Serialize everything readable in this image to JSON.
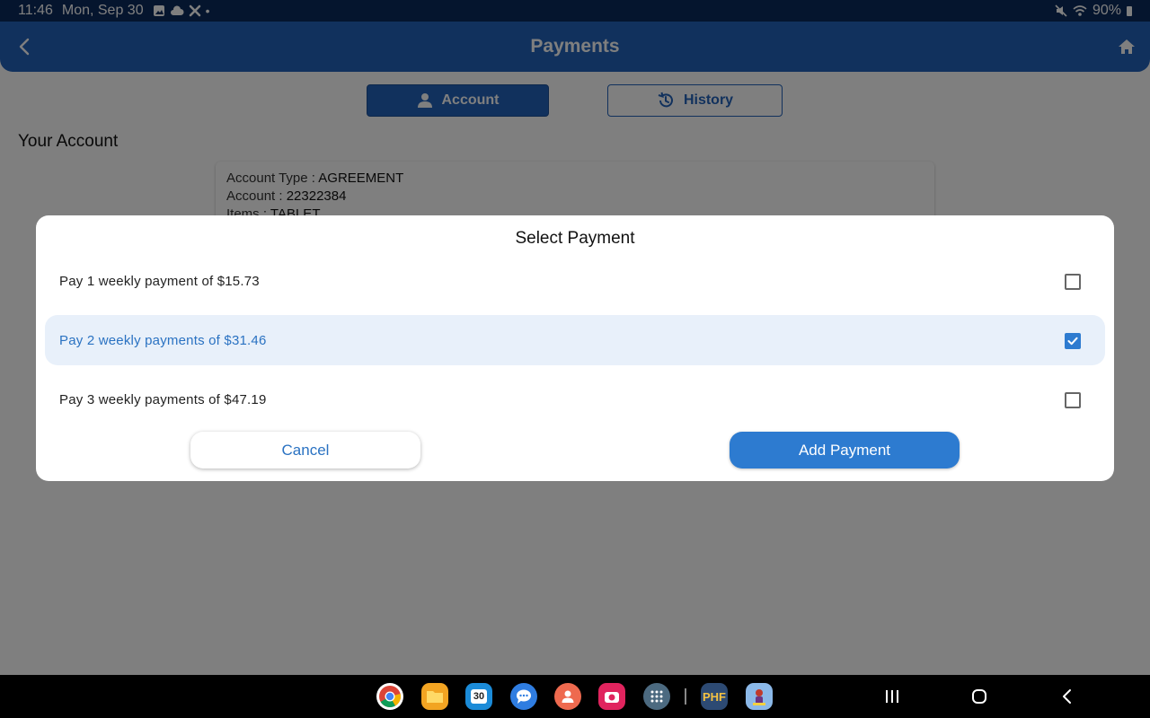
{
  "status_bar": {
    "time": "11:46",
    "date": "Mon, Sep 30",
    "dot": "•",
    "battery": "90%"
  },
  "header": {
    "title": "Payments"
  },
  "tabs": [
    {
      "label": "Account",
      "icon": "person-icon",
      "active": true
    },
    {
      "label": "History",
      "icon": "history-icon",
      "active": false
    }
  ],
  "section_title": "Your Account",
  "account_card": {
    "type_label": "Account Type : ",
    "type_value": "AGREEMENT",
    "account_label": "Account : ",
    "account_value": "22322384",
    "items_label": "Items : ",
    "items_value": "TABLET"
  },
  "dialog": {
    "title": "Select Payment",
    "options": [
      {
        "label": "Pay 1 weekly payment of $15.73",
        "checked": false
      },
      {
        "label": "Pay 2 weekly payments of $31.46",
        "checked": true
      },
      {
        "label": "Pay 3 weekly payments of $47.19",
        "checked": false
      }
    ],
    "cancel_label": "Cancel",
    "add_label": "Add Payment"
  },
  "dock": {
    "calendar_day": "30",
    "phf_label": "PHF"
  },
  "colors": {
    "primary": "#2263ba",
    "accent": "#2d7bd0",
    "status_bar": "#0b2a5c"
  }
}
